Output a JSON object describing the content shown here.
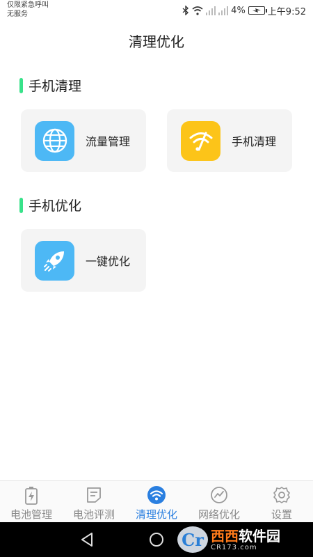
{
  "status_bar": {
    "carrier_line1": "仅限紧急呼叫",
    "carrier_line2": "无服务",
    "battery_percent": "4%",
    "time": "上午9:52"
  },
  "header": {
    "title": "清理优化"
  },
  "sections": [
    {
      "title": "手机清理",
      "cards": [
        {
          "label": "流量管理",
          "icon": "globe-icon",
          "color": "#4db8f5"
        },
        {
          "label": "手机清理",
          "icon": "wifi-broom-icon",
          "color": "#fcc419"
        }
      ]
    },
    {
      "title": "手机优化",
      "cards": [
        {
          "label": "一键优化",
          "icon": "rocket-icon",
          "color": "#4db8f5"
        }
      ]
    }
  ],
  "tabs": [
    {
      "label": "电池管理",
      "icon": "battery-icon",
      "active": false
    },
    {
      "label": "电池评测",
      "icon": "report-icon",
      "active": false
    },
    {
      "label": "清理优化",
      "icon": "wifi-icon",
      "active": true
    },
    {
      "label": "网络优化",
      "icon": "network-icon",
      "active": false
    },
    {
      "label": "设置",
      "icon": "gear-icon",
      "active": false
    }
  ],
  "watermark": {
    "brand_part1": "西西",
    "brand_part2": "软件园",
    "url": "CR173.com"
  },
  "colors": {
    "accent": "#38e28a",
    "tab_active": "#2a7fe0",
    "icon_blue": "#4db8f5",
    "icon_yellow": "#fcc419"
  }
}
